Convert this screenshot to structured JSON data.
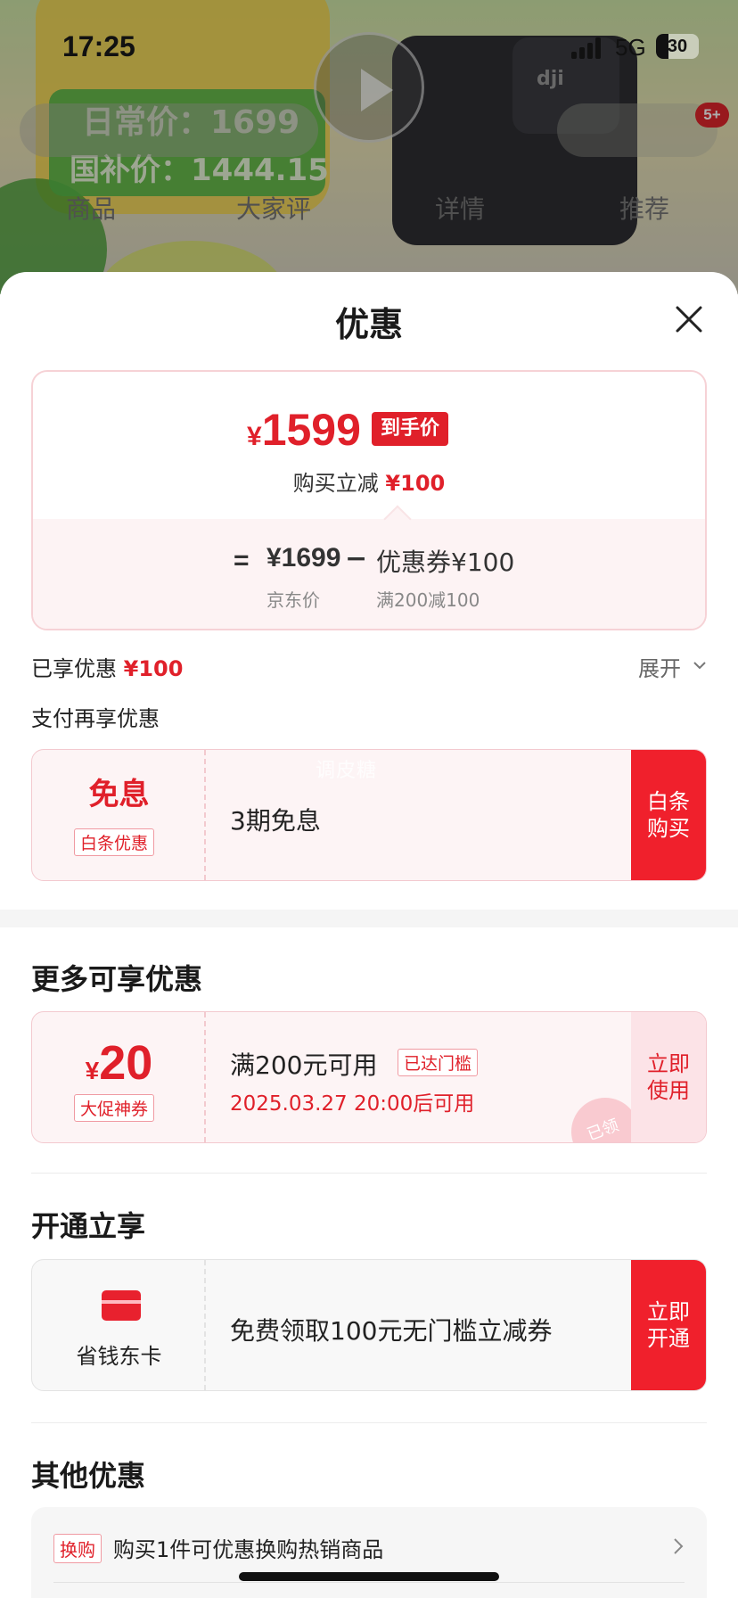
{
  "status_bar": {
    "time": "17:25",
    "network": "5G",
    "battery": "30",
    "battery_pct": 30
  },
  "background_page": {
    "price_daily": "日常价：1699",
    "price_subsidy": "国补价：1444.15",
    "brand_logo": "dji",
    "notification_count": "5+",
    "tabs": [
      "商品",
      "大家评",
      "详情",
      "推荐"
    ]
  },
  "sheet": {
    "title": "优惠",
    "close_icon": "close-icon",
    "price_card": {
      "currency": "¥",
      "final_price": "1599",
      "final_price_tag": "到手价",
      "reduce_label": "购买立减",
      "reduce_amount": "¥100",
      "equals": "=",
      "base_price": "¥1699",
      "minus": "−",
      "coupon_label": "优惠券¥100",
      "base_caption": "京东价",
      "coupon_caption": "满200减100"
    },
    "enjoyed": {
      "label": "已享优惠",
      "amount": "¥100",
      "expand_label": "展开",
      "expand_icon": "chevron-down-icon"
    },
    "pay_more_label": "支付再享优惠",
    "baitiao_tile": {
      "title": "免息",
      "tag": "白条优惠",
      "text": "3期免息",
      "button": "白条购买",
      "watermark": "调皮糖"
    },
    "more_section": {
      "heading": "更多可享优惠",
      "coupon": {
        "currency": "¥",
        "amount": "20",
        "tag": "大促神券",
        "condition": "满200元可用",
        "condition_tag": "已达门槛",
        "time": "2025.03.27 20:00后可用",
        "button": "立即使用",
        "stamp": "已领"
      }
    },
    "open_section": {
      "heading": "开通立享",
      "card": {
        "icon": "credit-card-icon",
        "name": "省钱东卡",
        "text": "免费领取100元无门槛立减券",
        "button": "立即开通"
      }
    },
    "other_section": {
      "heading": "其他优惠",
      "row": {
        "tag": "换购",
        "text": "购买1件可优惠换购热销商品",
        "icon": "chevron-right-icon"
      }
    }
  },
  "colors": {
    "accent": "#e0202a",
    "button_red": "#f0202c",
    "tile_bg": "#fdf4f5"
  }
}
